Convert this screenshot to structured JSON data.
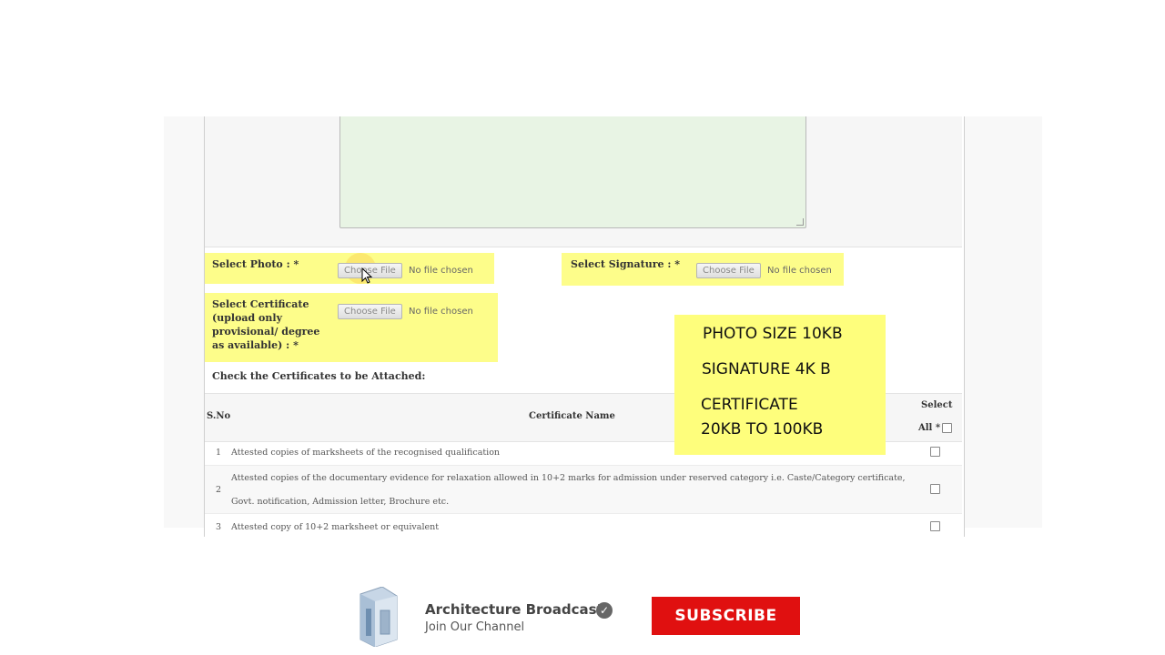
{
  "form": {
    "photo_label": "Select Photo : *",
    "signature_label": "Select Signature : *",
    "certificate_label": "Select Certificate\n(upload only\nprovisional/ degree\nas available) : *",
    "choose_file": "Choose File",
    "no_file": "No file chosen",
    "attach_heading": "Check the Certificates to be Attached:"
  },
  "table": {
    "col_sno": "S.No",
    "col_name": "Certificate Name",
    "col_select": "Select",
    "col_all": "All *",
    "rows": [
      {
        "sno": "1",
        "name": "Attested copies of marksheets of the recognised qualification"
      },
      {
        "sno": "2",
        "name_line1": "Attested copies of the documentary evidence for relaxation allowed in 10+2 marks for admission under reserved category i.e. Caste/Category certificate,",
        "name_line2": "Govt. notification, Admission letter, Brochure etc."
      },
      {
        "sno": "3",
        "name": "Attested copy of 10+2 marksheet or equivalent"
      }
    ]
  },
  "note": {
    "line1": "PHOTO SIZE 10KB",
    "line2": "SIGNATURE 4K B",
    "line3": "CERTIFICATE",
    "line4": "20KB TO 100KB"
  },
  "channel": {
    "name": "Architecture Broadcast",
    "tagline": "Join Our Channel",
    "subscribe": "SUBSCRIBE",
    "verified_mark": "✓"
  },
  "colors": {
    "highlight": "#fdfd8a",
    "note_bg": "#fefe7c",
    "textarea_bg": "#e8f4e4",
    "subscribe_bg": "#e01010"
  }
}
